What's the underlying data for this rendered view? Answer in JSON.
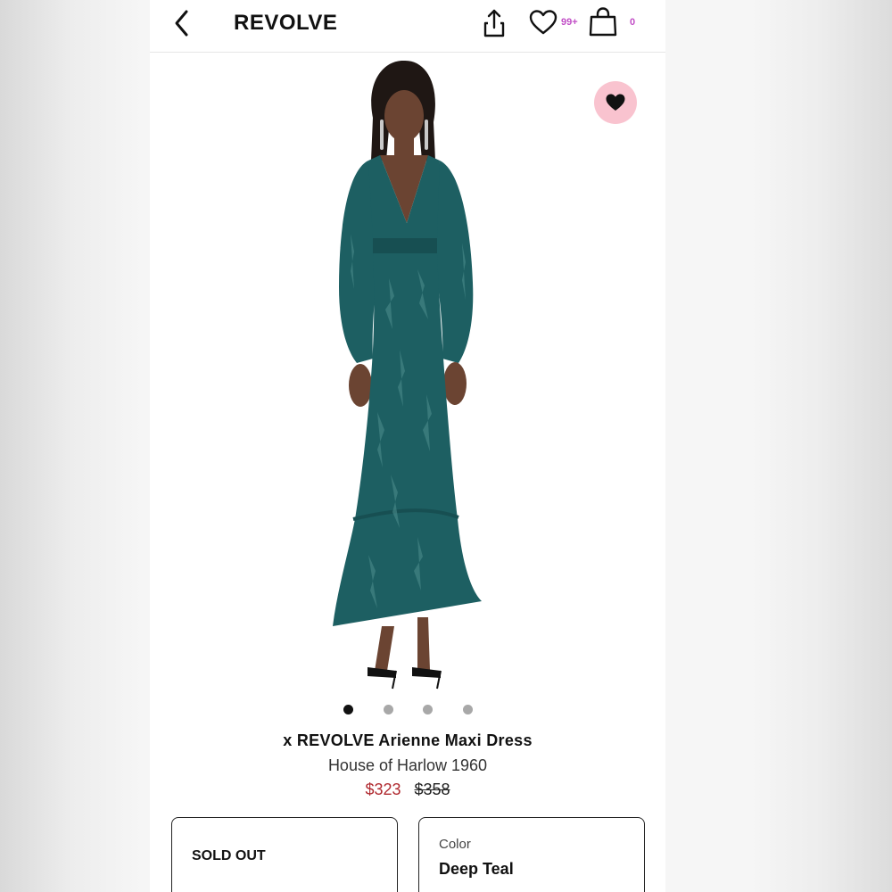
{
  "header": {
    "brand": "REVOLVE",
    "wishlist_count": "99+",
    "bag_count": "0"
  },
  "colors": {
    "accent_count": "#c14ec6",
    "sale_price": "#b02a30",
    "favorite_bg": "#f9c3cf",
    "dress": "#1d5f62"
  },
  "gallery": {
    "image_count": 4,
    "active_index": 0
  },
  "product": {
    "title": "x REVOLVE Arienne Maxi Dress",
    "designer": "House of Harlow 1960",
    "sale_price": "$323",
    "original_price": "$358"
  },
  "size_selector": {
    "status": "SOLD OUT"
  },
  "color_selector": {
    "label": "Color",
    "value": "Deep Teal"
  },
  "icons": [
    "back-chevron-icon",
    "share-icon",
    "heart-outline-icon",
    "shopping-bag-icon",
    "heart-filled-icon"
  ]
}
